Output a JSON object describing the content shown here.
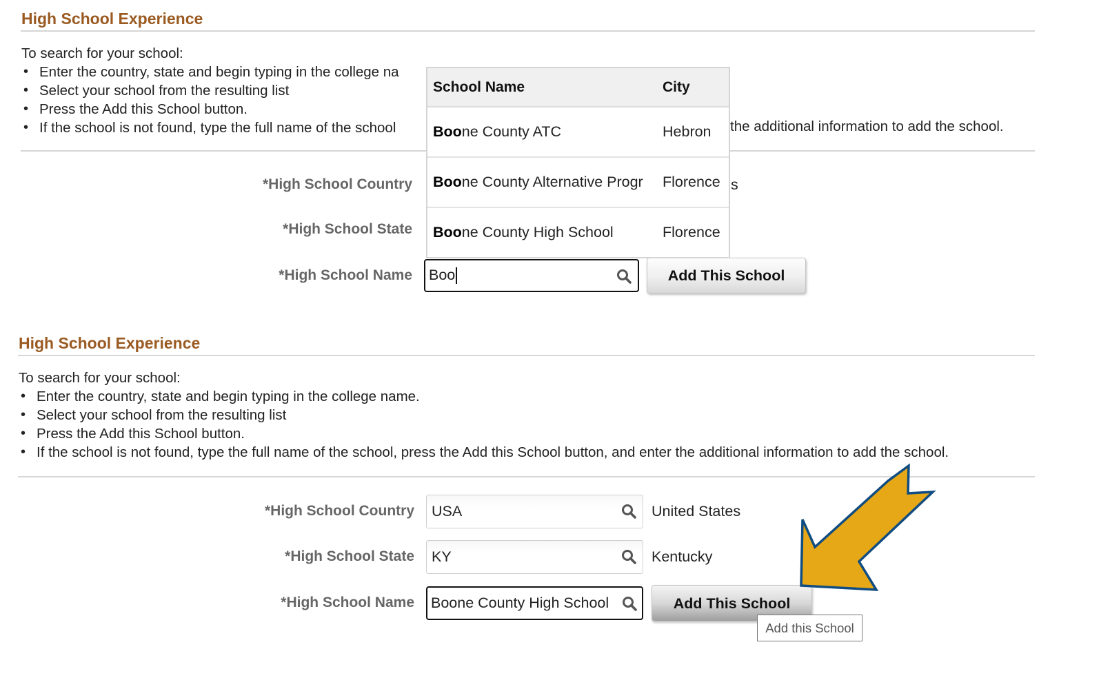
{
  "sections": [
    {
      "title": "High School Experience",
      "intro": "To search for your school:",
      "bullets": [
        "Enter the country, state and begin typing in the college name.",
        "Select your school from the resulting list",
        "Press the Add this School button.",
        "If the school is not found, type the full name of the school, press the Add this School button, and enter the additional information to add the school."
      ],
      "visible_fragments": {
        "bullet_1": "Enter the country, state and begin typing in the college na",
        "bullet_4_left": "If the school is not found, type the full name of the school",
        "bullet_4_right": "the additional information to add the school.",
        "country_desc_fragment": "s"
      },
      "form": {
        "country_label": "*High School Country",
        "state_label": "*High School State",
        "name_label": "*High School Name",
        "name_value": "Boo",
        "add_button": "Add This School"
      },
      "dropdown": {
        "columns": [
          "School Name",
          "City"
        ],
        "match_prefix": "Boo",
        "rows": [
          {
            "name_match": "Boo",
            "name_rest": "ne County ATC",
            "city": "Hebron"
          },
          {
            "name_match": "Boo",
            "name_rest": "ne County Alternative Progr",
            "city": "Florence"
          },
          {
            "name_match": "Boo",
            "name_rest": "ne County High School",
            "city": "Florence"
          }
        ]
      }
    },
    {
      "title": "High School Experience",
      "intro": "To search for your school:",
      "bullets": [
        "Enter the country, state and begin typing in the college name.",
        "Select your school from the resulting list",
        "Press the Add this School button.",
        "If the school is not found, type the full name of the school, press the Add this School button, and enter the additional information to add the school."
      ],
      "form": {
        "country_label": "*High School Country",
        "country_value": "USA",
        "country_desc": "United States",
        "state_label": "*High School State",
        "state_value": "KY",
        "state_desc": "Kentucky",
        "name_label": "*High School Name",
        "name_value": "Boone County High School",
        "add_button": "Add This School",
        "tooltip": "Add this School"
      }
    }
  ],
  "annotation": {
    "type": "arrow",
    "points_to": "Add This School button",
    "fill_color": "#e6a817",
    "stroke_color": "#0f4c81"
  },
  "colors": {
    "heading": "#9a5a22",
    "label": "#666666"
  }
}
